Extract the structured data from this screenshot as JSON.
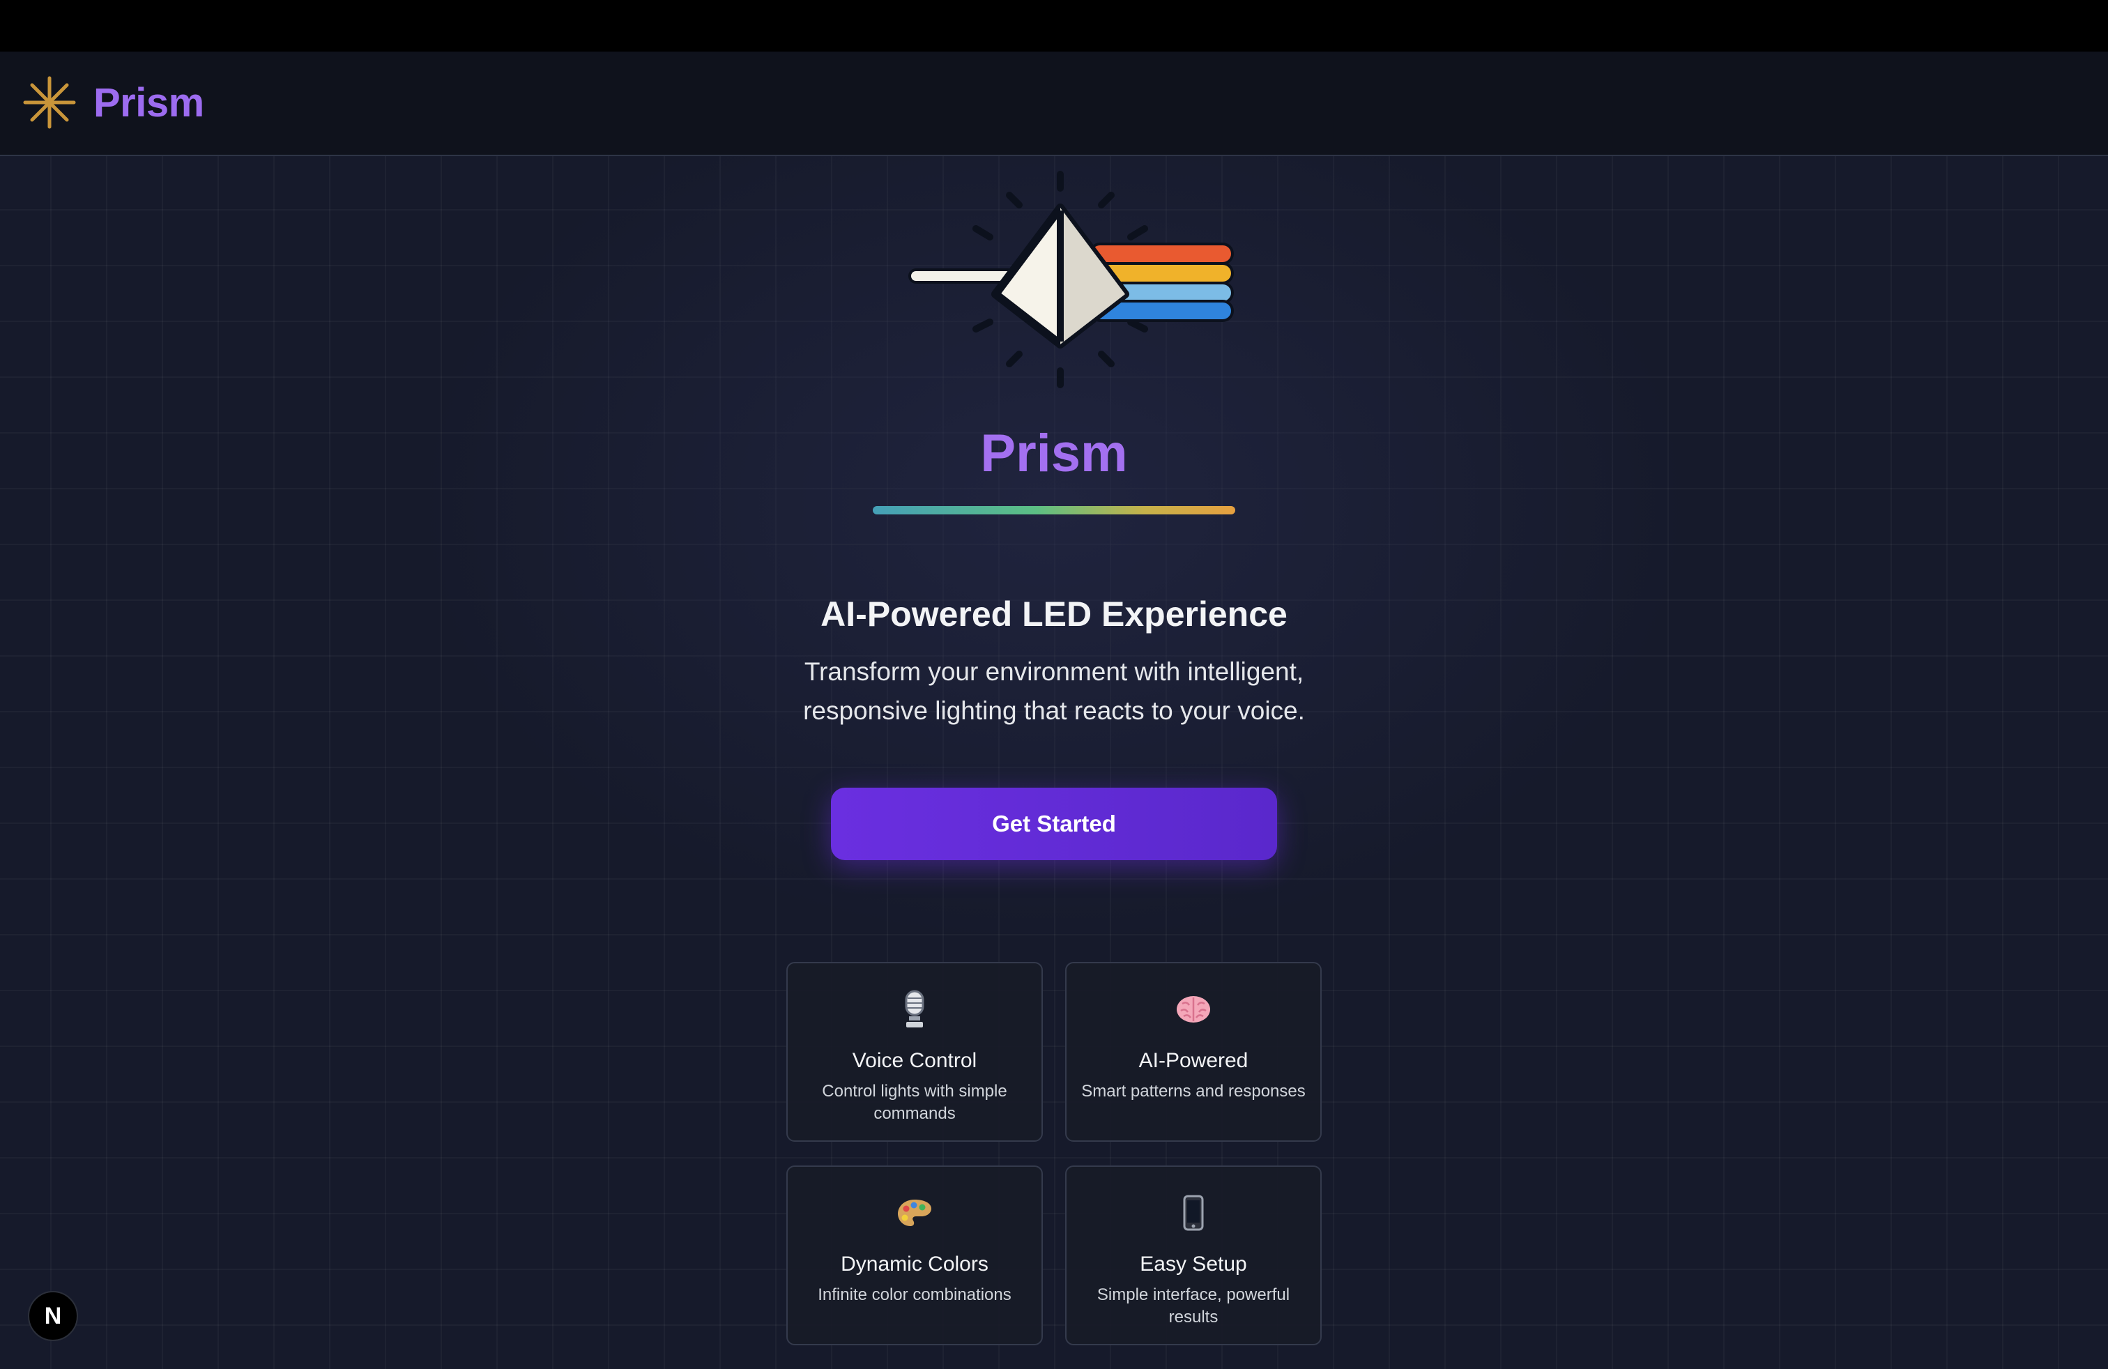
{
  "navbar": {
    "brand_name": "Prism",
    "logo_icon": "asterisk-icon"
  },
  "hero": {
    "graphic_icon": "prism-rainbow-icon",
    "title": "Prism",
    "tagline": "AI-Powered LED Experience",
    "description": "Transform your environment with intelligent, responsive lighting that reacts to your voice.",
    "cta_label": "Get Started"
  },
  "features": [
    {
      "icon": "microphone-icon",
      "title": "Voice Control",
      "description": "Control lights with simple commands"
    },
    {
      "icon": "brain-icon",
      "title": "AI-Powered",
      "description": "Smart patterns and responses"
    },
    {
      "icon": "palette-icon",
      "title": "Dynamic Colors",
      "description": "Infinite color combinations"
    },
    {
      "icon": "mobile-phone-icon",
      "title": "Easy Setup",
      "description": "Simple interface, powerful results"
    }
  ],
  "dev_badge": {
    "label": "N"
  },
  "colors": {
    "brand_purple": "#9d6cf0",
    "button_purple": "#6a2fe0",
    "logo_gold": "#c9953a",
    "background": "#161a2b"
  }
}
